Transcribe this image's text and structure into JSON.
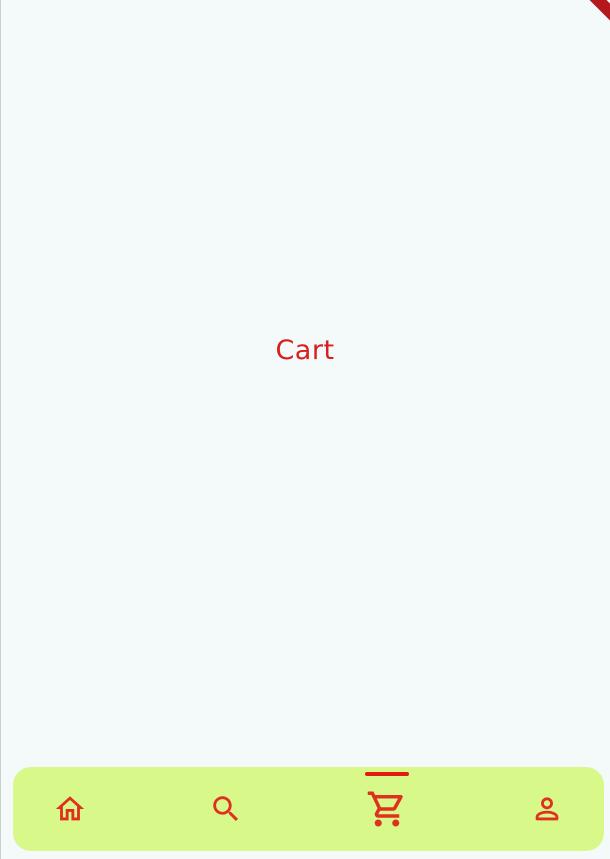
{
  "page": {
    "title": "Cart"
  },
  "bottom_nav": {
    "items": [
      {
        "id": "home",
        "icon": "home-icon",
        "active": false
      },
      {
        "id": "search",
        "icon": "search-icon",
        "active": false
      },
      {
        "id": "cart",
        "icon": "cart-icon",
        "active": true
      },
      {
        "id": "profile",
        "icon": "person-icon",
        "active": false
      }
    ]
  },
  "colors": {
    "background": "#f4f9fa",
    "accent": "#e0301e",
    "title": "#d61f1f",
    "nav_background": "#d8f98a",
    "active_indicator": "#e11d12"
  }
}
